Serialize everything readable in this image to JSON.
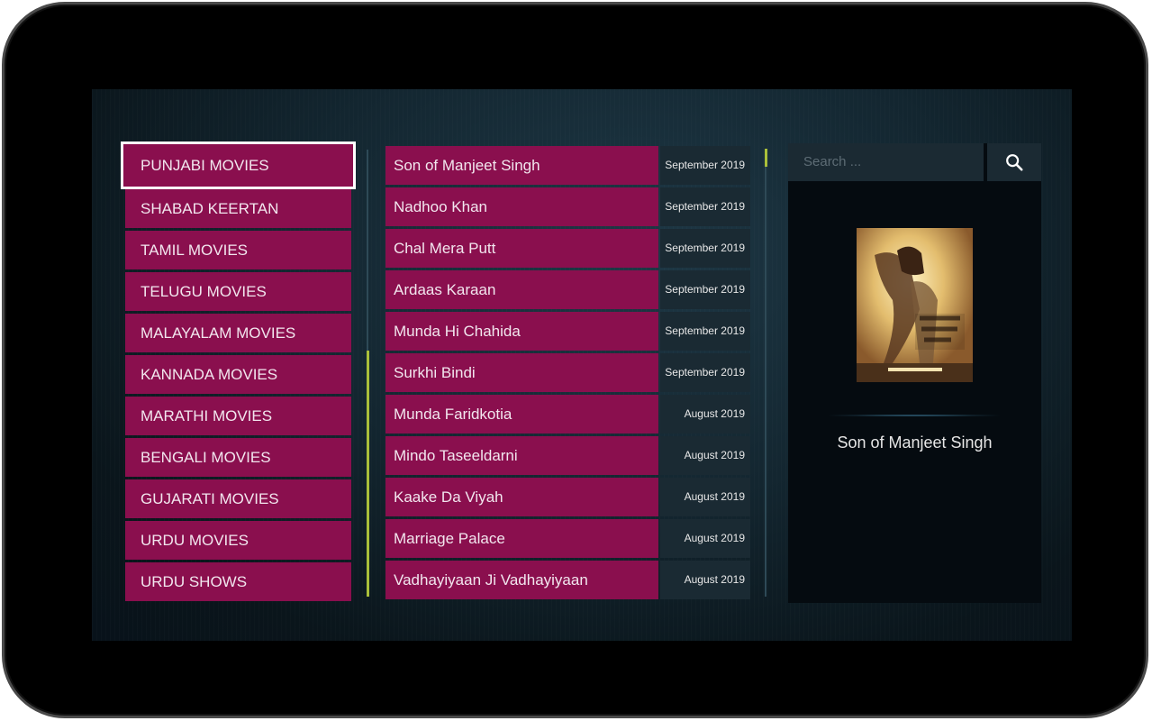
{
  "categories": [
    {
      "label": "PUNJABI MOVIES",
      "selected": true
    },
    {
      "label": "SHABAD KEERTAN"
    },
    {
      "label": "TAMIL MOVIES"
    },
    {
      "label": "TELUGU MOVIES"
    },
    {
      "label": "MALAYALAM MOVIES"
    },
    {
      "label": "KANNADA MOVIES"
    },
    {
      "label": "MARATHI MOVIES"
    },
    {
      "label": "BENGALI MOVIES"
    },
    {
      "label": "GUJARATI MOVIES"
    },
    {
      "label": "URDU MOVIES"
    },
    {
      "label": "URDU SHOWS"
    }
  ],
  "movies": [
    {
      "title": "Son of Manjeet Singh",
      "date": "September 2019"
    },
    {
      "title": "Nadhoo Khan",
      "date": "September 2019"
    },
    {
      "title": "Chal Mera Putt",
      "date": "September 2019"
    },
    {
      "title": "Ardaas Karaan",
      "date": "September 2019"
    },
    {
      "title": "Munda Hi Chahida",
      "date": "September 2019"
    },
    {
      "title": "Surkhi Bindi",
      "date": "September 2019"
    },
    {
      "title": "Munda Faridkotia",
      "date": "August 2019"
    },
    {
      "title": "Mindo Taseeldarni",
      "date": "August 2019"
    },
    {
      "title": "Kaake Da Viyah",
      "date": "August 2019"
    },
    {
      "title": "Marriage Palace",
      "date": "August 2019"
    },
    {
      "title": "Vadhayiyaan Ji Vadhayiyaan",
      "date": "August 2019"
    }
  ],
  "search": {
    "placeholder": "Search ...",
    "icon": "search-icon"
  },
  "detail": {
    "title": "Son of Manjeet Singh"
  },
  "colors": {
    "item_bg": "#8a0f4e",
    "scroll_thumb": "#a9bf3a",
    "panel_bg": "#050b10"
  }
}
